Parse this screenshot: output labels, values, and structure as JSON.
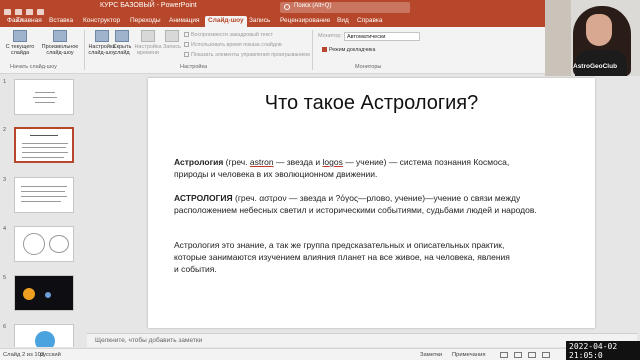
{
  "window": {
    "title": "КУРС БАЗОВЫЙ  -  PowerPoint",
    "search_placeholder": "Поиск (Alt+Q)"
  },
  "tabs": [
    {
      "label": "Файл"
    },
    {
      "label": "Главная"
    },
    {
      "label": "Вставка"
    },
    {
      "label": "Конструктор"
    },
    {
      "label": "Переходы"
    },
    {
      "label": "Анимация"
    },
    {
      "label": "Слайд-шоу",
      "active": true
    },
    {
      "label": "Запись"
    },
    {
      "label": "Рецензирование"
    },
    {
      "label": "Вид"
    },
    {
      "label": "Справка"
    }
  ],
  "ribbon": {
    "from_current": "С текущего слайда",
    "custom_show": "Произвольное слайд-шоу",
    "group_start": "Начать слайд-шоу",
    "setup_show": "Настройка слайд-шоу",
    "hide_slide": "Скрыть слайд",
    "rehearse": "Настройка времени",
    "record": "Запись",
    "chk_narration": "Воспроизвести закадровый текст",
    "chk_timings": "Использовать время показа слайдов",
    "chk_media": "Показать элементы управления проигрыванием",
    "group_setup": "Настройка",
    "monitor_label": "Монитор:",
    "monitor_value": "Автоматически",
    "presenter_view": "Режим докладчика",
    "group_monitors": "Мониторы"
  },
  "webcam": {
    "label": "AstroGeoClub"
  },
  "thumbnails": [
    {
      "num": "1"
    },
    {
      "num": "2",
      "title": "Что такое Астрология?"
    },
    {
      "num": "3"
    },
    {
      "num": "4"
    },
    {
      "num": "5"
    },
    {
      "num": "6"
    }
  ],
  "slide": {
    "title": "Что такое Астрология?",
    "p1_bold": "Астрология",
    "p1_a": " (греч. ",
    "p1_astron": "astron",
    "p1_b": " — звезда и ",
    "p1_logos": "logos",
    "p1_c": " — учение) —  система познания Космоса,",
    "p1_line2": "природы и человека в их эволюционном движении.",
    "p2_bold": "АСТРОЛОГИЯ",
    "p2_rest": " (греч. αστρον — звезда и ?όγος—рлово, учение)—учение о связи между",
    "p2_line2": "расположением небесных светил и историческими событиями, судьбами людей и народов.",
    "p3_line1": "Астрология это знание, а так же группа предсказательных и описательных практик,",
    "p3_line2": "которые занимаются изучением влияния планет на все живое, на человека,  явления",
    "p3_line3": "и события."
  },
  "notes_placeholder": "Щелкните, чтобы добавить заметки",
  "status": {
    "slide_counter": "Слайд 2 из 103",
    "language": "русский",
    "notes_btn": "Заметки",
    "comments_btn": "Примечания"
  },
  "timestamp": "2022-04-02  21:05:0"
}
